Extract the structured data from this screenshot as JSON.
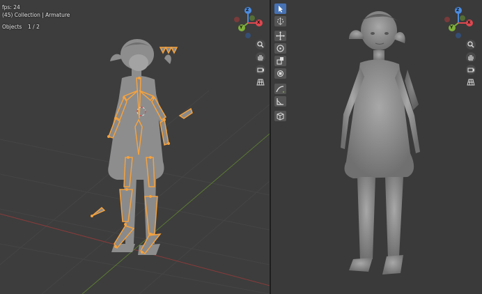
{
  "left_viewport": {
    "fps_text": "fps: 24",
    "collection_text": "(45) Collection | Armature",
    "objects_label": "Objects",
    "objects_count": "1 / 2"
  },
  "gizmo_axes": {
    "x": "X",
    "y": "Y",
    "z": "Z"
  },
  "colors": {
    "x_axis": "#e0474f",
    "y_axis": "#7fb03a",
    "z_axis": "#4b8ce0",
    "bone_outline": "#f5a23e",
    "active_tool": "#4772b3"
  },
  "nav_icons": [
    "zoom-icon",
    "hand-pan-icon",
    "camera-icon",
    "grid-perspective-icon"
  ],
  "toolbar_icons": [
    "select-cursor-icon",
    "cursor-3d-icon",
    "move-icon",
    "rotate-icon",
    "scale-icon",
    "transform-icon",
    "annotate-icon",
    "measure-icon",
    "add-cube-icon"
  ]
}
